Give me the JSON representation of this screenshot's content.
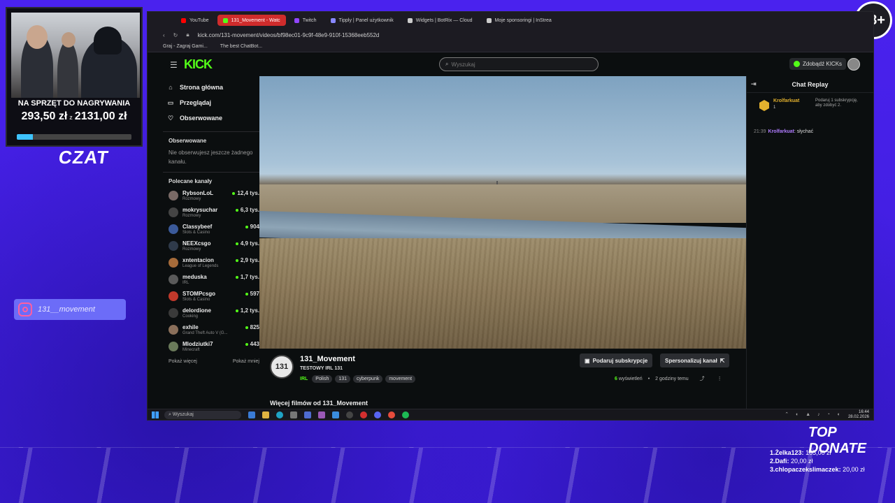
{
  "overlay": {
    "age_badge": "18+",
    "donation_goal": {
      "title": "NA SPRZĘT DO NAGRYWANIA",
      "current": "293,50 zł",
      "separator": "z",
      "target": "2131,00 zł",
      "progress_fraction": 0.138
    },
    "czat_logo": "CZAT",
    "instagram": {
      "handle": "131__movement",
      "icon": "instagram-icon"
    },
    "top_donate": {
      "title": "TOP DONATE",
      "entries": [
        {
          "rank": "1.",
          "name": "Żelka123:",
          "amount": "105,00 zł"
        },
        {
          "rank": "2.",
          "name": "Dafi:",
          "amount": "20,00 zł"
        },
        {
          "rank": "3.",
          "name": "chlopaczekslimaczek:",
          "amount": "20,00 zł"
        }
      ]
    }
  },
  "browser": {
    "tabs": [
      {
        "label": "YouTube",
        "color": "#ff0000",
        "active": false
      },
      {
        "label": "131_Movement - Watc",
        "color": "#53fc18",
        "active": true
      },
      {
        "label": "Twitch",
        "color": "#9146ff",
        "active": false
      },
      {
        "label": "Tipply | Panel użytkownik",
        "color": "#8888ff",
        "active": false
      },
      {
        "label": "Widgets | BotRix — Cloud",
        "color": "#cccccc",
        "active": false
      },
      {
        "label": "Moje sponsoringi | InStrea",
        "color": "#cccccc",
        "active": false
      }
    ],
    "url": "kick.com/131-movement/videos/bf98ec01-9c9f-48e9-910f-15368eeb552d",
    "bookmarks": [
      "Graj - Zagraj Gami...",
      "The best ChatBot..."
    ]
  },
  "kick": {
    "logo": "KICK",
    "search_placeholder": "Wyszukaj",
    "get_kicks_label": "Zdobądź KICKs",
    "nav": [
      {
        "label": "Strona główna",
        "icon": "home-icon",
        "glyph": "⌂"
      },
      {
        "label": "Przeglądaj",
        "icon": "browse-icon",
        "glyph": "▭"
      },
      {
        "label": "Obserwowane",
        "icon": "heart-icon",
        "glyph": "♡"
      }
    ],
    "following_title": "Obserwowane",
    "following_empty": "Nie obserwujesz jeszcze żadnego kanału.",
    "recommended_title": "Polecane kanały",
    "channels": [
      {
        "name": "RybsonLoL",
        "category": "Rozmowy",
        "viewers": "12,4 tys."
      },
      {
        "name": "mokrysuchar",
        "category": "Rozmowy",
        "viewers": "6,3 tys."
      },
      {
        "name": "Classybeef",
        "category": "Slots & Casino",
        "viewers": "904"
      },
      {
        "name": "NEEXcsgo",
        "category": "Rozmowy",
        "viewers": "4,9 tys."
      },
      {
        "name": "xntentacion",
        "category": "League of Legends",
        "viewers": "2,9 tys."
      },
      {
        "name": "meduska",
        "category": "IRL",
        "viewers": "1,7 tys."
      },
      {
        "name": "STOMPcsgo",
        "category": "Slots & Casino",
        "viewers": "597"
      },
      {
        "name": "delordione",
        "category": "Cooking",
        "viewers": "1,2 tys."
      },
      {
        "name": "exhile",
        "category": "Grand Theft Auto V (G...",
        "viewers": "825"
      },
      {
        "name": "Mlodziutki7",
        "category": "Minecraft",
        "viewers": "443"
      }
    ],
    "show_more": "Pokaż więcej",
    "show_less": "Pokaż mniej",
    "stream": {
      "avatar_text": "131",
      "streamer": "131_Movement",
      "title": "TESTOWY IRL 131",
      "category": "IRL",
      "tags": [
        "Polish",
        "131",
        "cyberpunk",
        "movement"
      ],
      "gift_sub_label": "Podaruj subskrypcje",
      "sponsor_label": "Spersonalizuj kanał",
      "views": "6",
      "views_label": "wyświetleń",
      "age": "2 godziny temu",
      "more_videos": "Więcej filmów od 131_Movement"
    },
    "chat": {
      "title": "Chat Replay",
      "pinned": {
        "user": "Krolfarkuat",
        "count": "1",
        "text": "Podaruj 1 subskrypcję, aby zdobyć 2."
      },
      "messages": [
        {
          "time": "21:39",
          "user": "Krolfarkuat",
          "text": "słychać"
        }
      ]
    }
  },
  "taskbar": {
    "search_placeholder": "Wyszukaj",
    "time": "16:44",
    "date": "28.02.2026"
  }
}
